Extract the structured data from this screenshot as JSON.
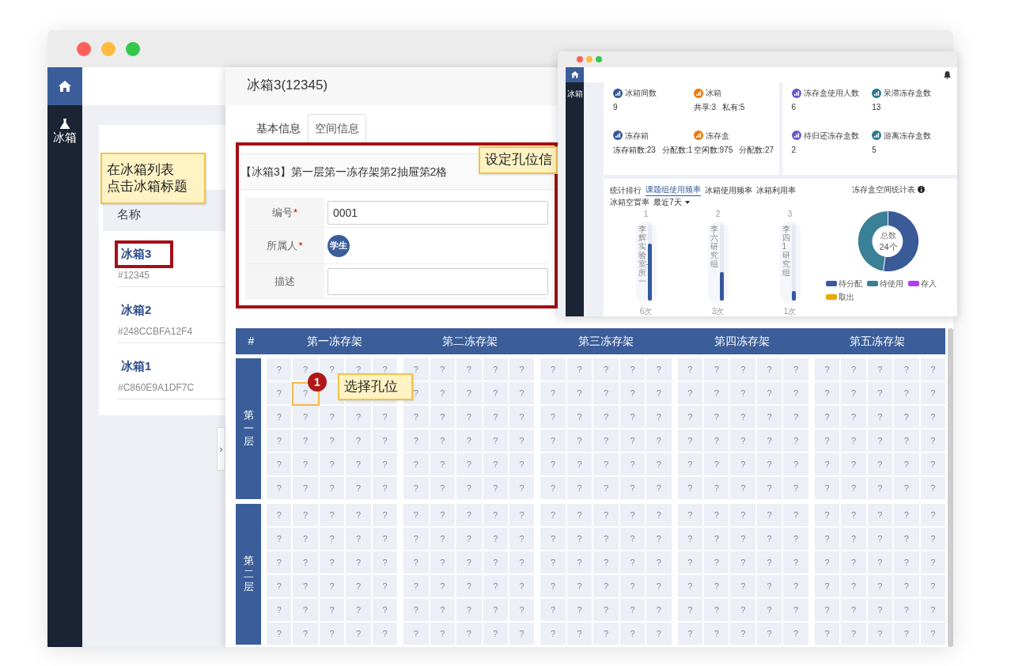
{
  "main_window": {
    "sidebar": [
      {
        "kind": "home",
        "selected": true
      },
      {
        "kind": "flask",
        "label": "冰箱",
        "selected": false
      }
    ],
    "fridge_list": {
      "header": "名称",
      "items": [
        {
          "name": "冰箱3",
          "code": "#12345",
          "highlighted": true
        },
        {
          "name": "冰箱2",
          "code": "#248CCBFA12F4",
          "highlighted": false
        },
        {
          "name": "冰箱1",
          "code": "#C860E9A1DF7C",
          "highlighted": false
        }
      ]
    },
    "toggle": "›",
    "drawer": {
      "title": "冰箱3(12345)",
      "tabs": [
        {
          "label": "基本信息",
          "selected": false
        },
        {
          "label": "空间信息",
          "selected": true
        }
      ],
      "form": {
        "highlighted": true,
        "location": "【冰箱3】第一层第一冻存架第2抽屉第2格",
        "fields": [
          {
            "label": "编号",
            "mark": "*",
            "kind": "text",
            "value": "0001"
          },
          {
            "label": "所属人",
            "mark": "*",
            "kind": "avatar",
            "value": "学生"
          },
          {
            "label": "描述",
            "kind": "text"
          }
        ]
      },
      "grid": {
        "corner": "#",
        "racks": [
          "第一冻存架",
          "第二冻存架",
          "第三冻存架",
          "第四冻存架",
          "第五冻存架"
        ],
        "layers": [
          {
            "label": "第一层",
            "rows": [
              [
                "?",
                "?",
                "?",
                "?",
                "?",
                "?",
                "?",
                "?",
                "?",
                "?",
                "?",
                "?",
                "?",
                "?",
                "?",
                "?",
                "?",
                "?",
                "?",
                "?",
                "?",
                "?",
                "?",
                "?",
                "?"
              ],
              [
                "?",
                "?",
                null,
                null,
                null,
                "?",
                "?",
                "?",
                "?",
                "?",
                "?",
                "?",
                "?",
                "?",
                "?",
                "?",
                "?",
                "?",
                "?",
                "?",
                "?",
                "?",
                "?",
                "?",
                "?"
              ],
              [
                "?",
                "?",
                "?",
                "?",
                "?",
                "?",
                "?",
                "?",
                "?",
                "?",
                "?",
                "?",
                "?",
                "?",
                "?",
                "?",
                "?",
                "?",
                "?",
                "?",
                "?",
                "?",
                "?",
                "?",
                "?"
              ],
              [
                "?",
                "?",
                "?",
                "?",
                "?",
                "?",
                "?",
                "?",
                "?",
                "?",
                "?",
                "?",
                "?",
                "?",
                "?",
                "?",
                "?",
                "?",
                "?",
                "?",
                "?",
                "?",
                "?",
                "?",
                "?"
              ],
              [
                "?",
                "?",
                "?",
                "?",
                "?",
                "?",
                "?",
                "?",
                "?",
                "?",
                "?",
                "?",
                "?",
                "?",
                "?",
                "?",
                "?",
                "?",
                "?",
                "?",
                "?",
                "?",
                "?",
                "?",
                "?"
              ],
              [
                "?",
                "?",
                "?",
                "?",
                "?",
                "?",
                "?",
                "?",
                "?",
                "?",
                "?",
                "?",
                "?",
                "?",
                "?",
                "?",
                "?",
                "?",
                "?",
                "?",
                "?",
                "?",
                "?",
                "?",
                "?"
              ]
            ]
          },
          {
            "label": "第二层",
            "rows": [
              [
                "?",
                "?",
                "?",
                "?",
                "?",
                "?",
                "?",
                "?",
                "?",
                "?",
                "?",
                "?",
                "?",
                "?",
                "?",
                "?",
                "?",
                "?",
                "?",
                "?",
                "?",
                "?",
                "?",
                "?",
                "?"
              ],
              [
                "?",
                "?",
                "?",
                "?",
                "?",
                "?",
                "?",
                "?",
                "?",
                "?",
                "?",
                "?",
                "?",
                "?",
                "?",
                "?",
                "?",
                "?",
                "?",
                "?",
                "?",
                "?",
                "?",
                "?",
                "?"
              ],
              [
                "?",
                "?",
                "?",
                "?",
                "?",
                "?",
                "?",
                "?",
                "?",
                "?",
                "?",
                "?",
                "?",
                "?",
                "?",
                "?",
                "?",
                "?",
                "?",
                "?",
                "?",
                "?",
                "?",
                "?",
                "?"
              ],
              [
                "?",
                "?",
                "?",
                "?",
                "?",
                "?",
                "?",
                "?",
                "?",
                "?",
                "?",
                "?",
                "?",
                "?",
                "?",
                "?",
                "?",
                "?",
                "?",
                "?",
                "?",
                "?",
                "?",
                "?",
                "?"
              ],
              [
                "?",
                "?",
                "?",
                "?",
                "?",
                "?",
                "?",
                "?",
                "?",
                "?",
                "?",
                "?",
                "?",
                "?",
                "?",
                "?",
                "?",
                "?",
                "?",
                "?",
                "?",
                "?",
                "?",
                "?",
                "?"
              ],
              [
                "?",
                "?",
                "?",
                "?",
                "?",
                "?",
                "?",
                "?",
                "?",
                "?",
                "?",
                "?",
                "?",
                "?",
                "?",
                "?",
                "?",
                "?",
                "?",
                "?",
                "?",
                "?",
                "?",
                "?",
                "?"
              ]
            ]
          }
        ]
      }
    }
  },
  "dashboard_window": {
    "sidebar": [
      {
        "kind": "home",
        "selected": true
      },
      {
        "kind": "flask",
        "label": "冰箱",
        "selected": false
      }
    ],
    "stat_cards": [
      {
        "items": [
          {
            "label": "冰箱间数",
            "color": "#34589a",
            "values": [
              "9"
            ]
          },
          {
            "label": "冰箱",
            "color": "#f07800",
            "values": [
              "共享:3",
              "私有:5"
            ]
          },
          {
            "label": "冻存箱",
            "color": "#34589a",
            "values": [
              "冻存箱数:23",
              "分配数:1"
            ]
          },
          {
            "label": "冻存盒",
            "color": "#f07800",
            "values": [
              "空闲数:975",
              "分配数:27"
            ]
          }
        ]
      },
      {
        "items": [
          {
            "label": "冻存盒使用人数",
            "color": "#6a58d0",
            "values": [
              "6"
            ]
          },
          {
            "label": "呆滞冻存盒数",
            "color": "#2e7890",
            "values": [
              "13"
            ]
          },
          {
            "label": "待归还冻存盒数",
            "color": "#6a58d0",
            "values": [
              "2"
            ]
          },
          {
            "label": "游离冻存盒数",
            "color": "#2e7890",
            "values": [
              "5"
            ]
          }
        ]
      }
    ],
    "ranking": {
      "title": "统计排行",
      "tabs": [
        {
          "label": "课题组使用频率",
          "selected": true
        },
        {
          "label": "冰箱使用频率",
          "selected": false
        },
        {
          "label": "冰箱利用率",
          "selected": false
        },
        {
          "label": "冰箱空置率",
          "selected": false
        }
      ],
      "period": "最近7天",
      "bars": [
        {
          "rank": "1",
          "name": "李辉实验室-所一",
          "level": 0.75,
          "count": "6次"
        },
        {
          "rank": "2",
          "name": "李六研究组",
          "level": 0.38,
          "count": "3次"
        },
        {
          "rank": "3",
          "name": "李四1研究组",
          "level": 0.12,
          "count": "1次"
        }
      ]
    },
    "space_chart": {
      "title": "冻存盒空间统计表",
      "center_label": "总数",
      "center_value": "24个",
      "legend": [
        {
          "label": "待分配",
          "color": "#3a5a98"
        },
        {
          "label": "待使用",
          "color": "#3a8096"
        },
        {
          "label": "存入",
          "color": "#b040f0"
        },
        {
          "label": "取出",
          "color": "#e8a800"
        }
      ]
    }
  },
  "annotations": [
    {
      "kind": "note",
      "lines": [
        "在冰箱列表",
        "点击冰箱标题"
      ]
    },
    {
      "kind": "note",
      "lines": [
        "设定孔位信"
      ]
    },
    {
      "kind": "marker",
      "text": "1"
    },
    {
      "kind": "note",
      "lines": [
        "选择孔位"
      ]
    },
    {
      "kind": "cell-frame"
    }
  ]
}
